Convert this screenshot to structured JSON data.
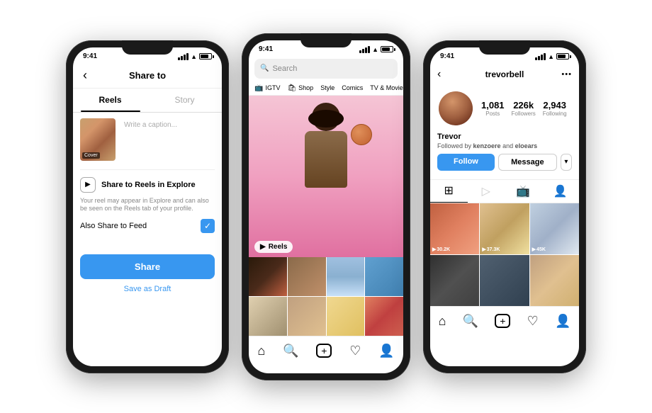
{
  "phone1": {
    "status_time": "9:41",
    "nav_title": "Share to",
    "back_label": "‹",
    "tab_reels": "Reels",
    "tab_story": "Story",
    "caption_placeholder": "Write a caption...",
    "thumb_label": "Cover",
    "explore_icon": "⊡",
    "explore_title": "Share to Reels in Explore",
    "explore_desc": "Your reel may appear in Explore and can also be seen on the Reels tab of your profile.",
    "also_share_label": "Also Share to Feed",
    "check_mark": "✓",
    "share_button": "Share",
    "draft_button": "Save as Draft"
  },
  "phone2": {
    "status_time": "9:41",
    "search_placeholder": "Search",
    "categories": [
      {
        "icon": "📺",
        "label": "IGTV"
      },
      {
        "icon": "🛍",
        "label": "Shop"
      },
      {
        "icon": "",
        "label": "Style"
      },
      {
        "icon": "",
        "label": "Comics"
      },
      {
        "icon": "🎬",
        "label": "TV & Movie"
      }
    ],
    "reels_badge": "Reels",
    "nav_icons": [
      "⌂",
      "🔍",
      "+",
      "♡",
      "👤"
    ]
  },
  "phone3": {
    "status_time": "9:41",
    "back_label": "‹",
    "username": "trevorbell",
    "more_icon": "•••",
    "stats": [
      {
        "num": "1,081",
        "label": "Posts"
      },
      {
        "num": "226k",
        "label": "Followers"
      },
      {
        "num": "2,943",
        "label": "Following"
      }
    ],
    "profile_name": "Trevor",
    "followed_by": "Followed by kenzoere and eloears",
    "followed_by_names": [
      "kenzoere",
      "eloears"
    ],
    "follow_label": "Follow",
    "message_label": "Message",
    "dropdown_icon": "▾",
    "grid_icons": [
      "⊞",
      "▶",
      "📺",
      "👤"
    ],
    "play_counts": [
      "30.2K",
      "37.3K",
      "45K",
      "",
      "",
      ""
    ]
  },
  "colors": {
    "accent_blue": "#3897f0",
    "phone_bg": "#1a1a1a",
    "tab_active": "#000000"
  }
}
